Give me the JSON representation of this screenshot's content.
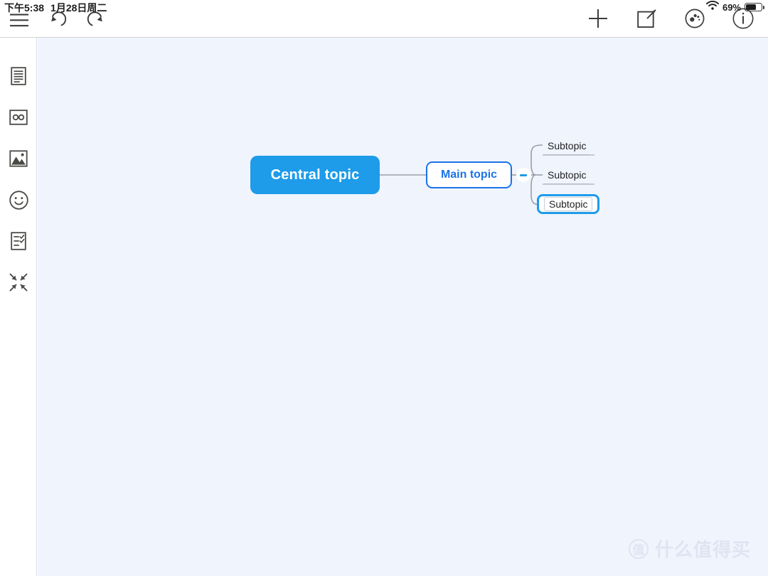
{
  "status_bar": {
    "time": "下午5:38",
    "date": "1月28日周二",
    "wifi_icon": "wifi-icon",
    "battery_percent": "69%",
    "battery_level": 69
  },
  "toolbar": {
    "left_buttons": [
      {
        "name": "menu-button",
        "icon": "hamburger-menu-icon",
        "label": "菜单"
      },
      {
        "name": "undo-button",
        "icon": "undo-arrow-icon",
        "label": "撤销"
      },
      {
        "name": "redo-button",
        "icon": "redo-arrow-icon",
        "label": "重做"
      }
    ],
    "right_buttons": [
      {
        "name": "add-button",
        "icon": "plus-icon",
        "label": "添加"
      },
      {
        "name": "edit-button",
        "icon": "pencil-square-icon",
        "label": "编辑"
      },
      {
        "name": "style-button",
        "icon": "style-palette-icon",
        "label": "样式"
      },
      {
        "name": "info-button",
        "icon": "info-circle-icon",
        "label": "信息"
      }
    ]
  },
  "sidebar": {
    "items": [
      {
        "name": "sidebar-item-notes",
        "icon": "document-notes-icon",
        "label": "备注"
      },
      {
        "name": "sidebar-item-relationship",
        "icon": "relationship-link-icon",
        "label": "关联"
      },
      {
        "name": "sidebar-item-image",
        "icon": "image-picture-icon",
        "label": "图片"
      },
      {
        "name": "sidebar-item-sticker",
        "icon": "smiley-face-icon",
        "label": "贴纸"
      },
      {
        "name": "sidebar-item-task",
        "icon": "checklist-task-icon",
        "label": "任务"
      },
      {
        "name": "sidebar-item-collapse",
        "icon": "collapse-arrows-icon",
        "label": "收起"
      }
    ]
  },
  "canvas": {
    "background_color": "#f0f4fd",
    "connector_color": "#9a9ea6"
  },
  "mindmap": {
    "central": {
      "text": "Central topic",
      "fill": "#1e9be9",
      "text_color": "#ffffff"
    },
    "main": {
      "text": "Main topic",
      "fill": "#ffffff",
      "border_color": "#1a73e8",
      "text_color": "#1a73e8"
    },
    "collapse_toggle": {
      "state": "expanded",
      "symbol": "minus",
      "color": "#1e9be9"
    },
    "subtopics": [
      {
        "text": "Subtopic",
        "selected": false
      },
      {
        "text": "Subtopic",
        "selected": false
      },
      {
        "text": "Subtopic",
        "selected": true
      }
    ],
    "selection_color": "#1e9be9"
  },
  "watermark": {
    "logo_text": "值",
    "text": "什么值得买",
    "color": "#dfe4f2"
  }
}
